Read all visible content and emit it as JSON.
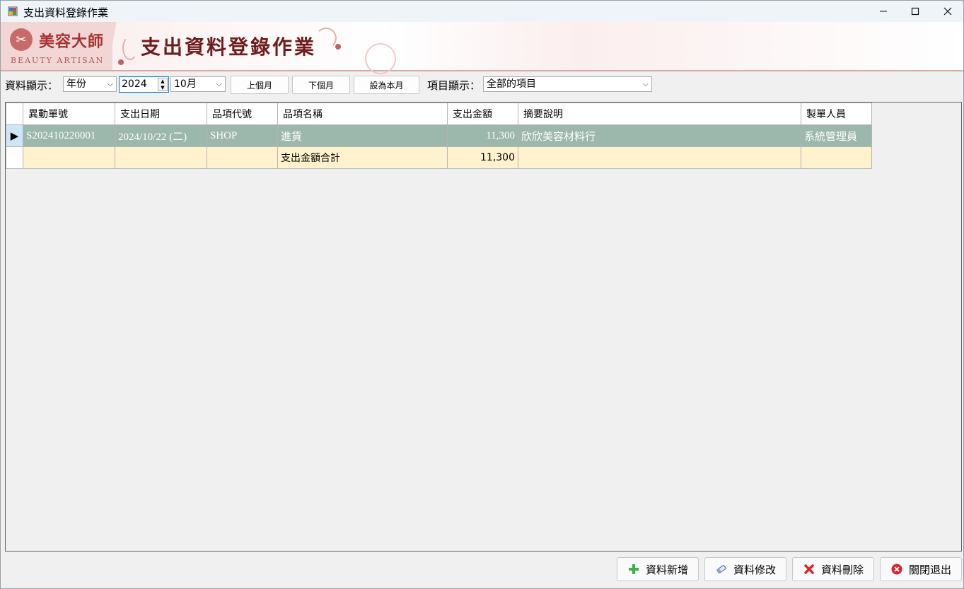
{
  "window": {
    "title": "支出資料登錄作業",
    "controls": {
      "minimize": "—",
      "maximize": "☐",
      "close": "✕"
    }
  },
  "banner": {
    "logo_cn": "美容大師",
    "logo_en": "BEAUTY ARTISAN",
    "title": "支出資料登錄作業"
  },
  "toolbar": {
    "data_display_label": "資料顯示：",
    "period_type": "年份",
    "year": "2024",
    "month": "10月",
    "prev_month": "上個月",
    "next_month": "下個月",
    "set_this_month": "設為本月",
    "item_display_label": "項目顯示：",
    "item_filter": "全部的項目"
  },
  "grid": {
    "columns": [
      "異動單號",
      "支出日期",
      "品項代號",
      "品項名稱",
      "支出金額",
      "摘要說明",
      "製單人員"
    ],
    "rows": [
      {
        "id": "S202410220001",
        "date": "2024/10/22 (二)",
        "code": "SHOP",
        "name": "進貨",
        "amount": "11,300",
        "memo": "欣欣美容材料行",
        "maker": "系統管理員"
      }
    ],
    "total": {
      "label": "支出金額合計",
      "amount": "11,300"
    }
  },
  "buttons": {
    "add": "資料新增",
    "edit": "資料修改",
    "delete": "資料刪除",
    "close": "關閉退出"
  },
  "colors": {
    "selected_row": "#9cb7ac",
    "total_row": "#fff2cc",
    "banner_title": "#6e1d1d",
    "add_icon": "#3cb043",
    "delete_icon": "#d9252a"
  }
}
